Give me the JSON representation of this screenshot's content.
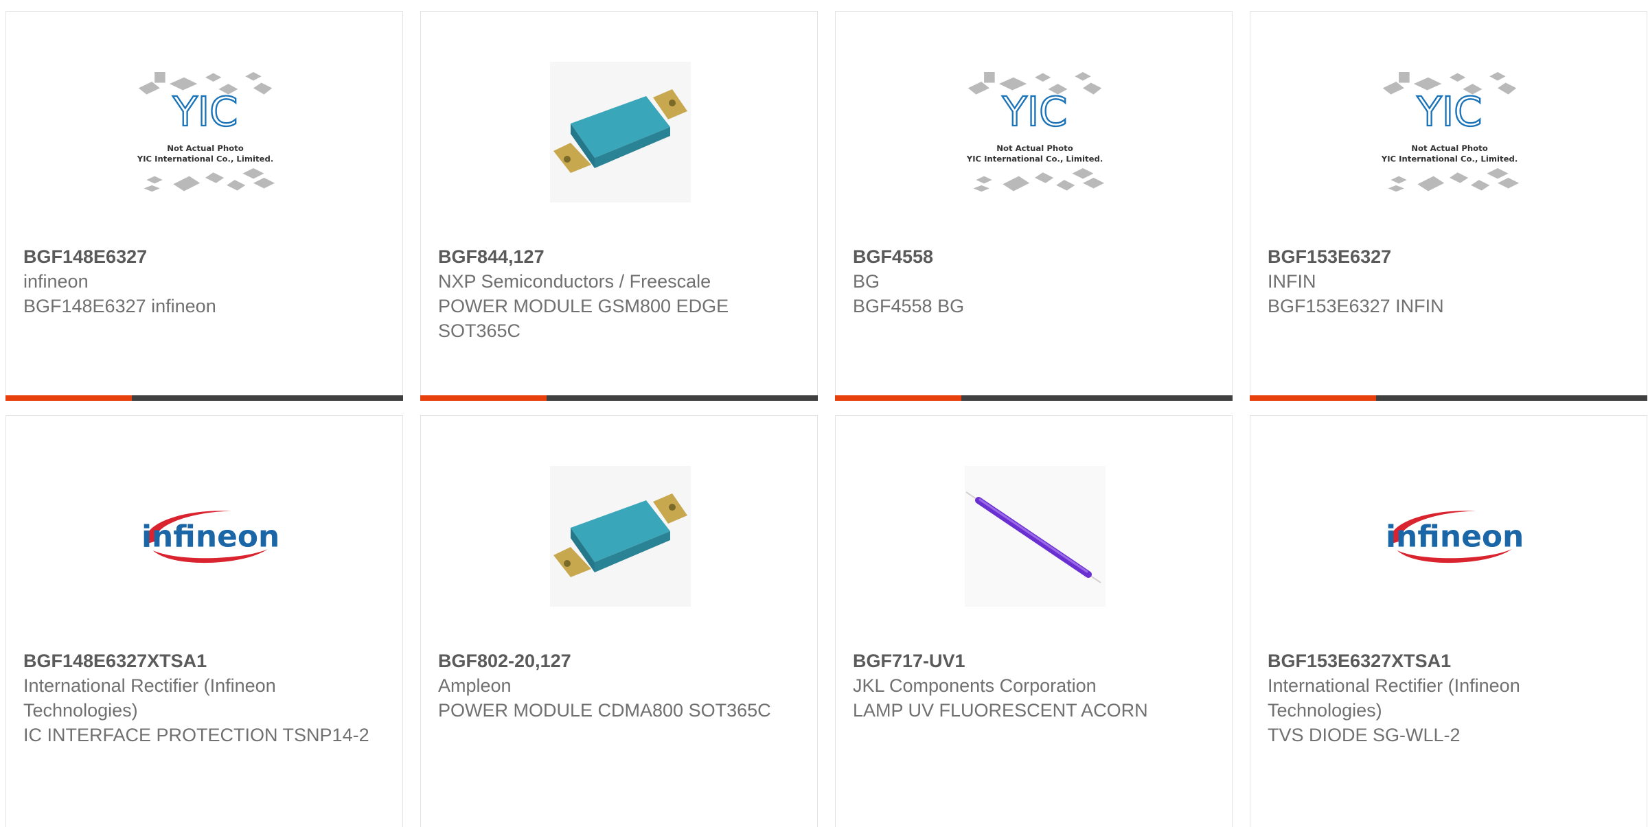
{
  "products": [
    {
      "part_number": "BGF148E6327",
      "manufacturer": "infineon",
      "description": "BGF148E6327 infineon",
      "image": "yic-placeholder",
      "image_caption_1": "Not Actual Photo",
      "image_caption_2": "YIC International Co., Limited."
    },
    {
      "part_number": "BGF844,127",
      "manufacturer": "NXP Semiconductors / Freescale",
      "description": "POWER MODULE GSM800 EDGE SOT365C",
      "image": "power-module-photo"
    },
    {
      "part_number": "BGF4558",
      "manufacturer": "BG",
      "description": "BGF4558 BG",
      "image": "yic-placeholder",
      "image_caption_1": "Not Actual Photo",
      "image_caption_2": "YIC International Co., Limited."
    },
    {
      "part_number": "BGF153E6327",
      "manufacturer": "INFIN",
      "description": "BGF153E6327 INFIN",
      "image": "yic-placeholder",
      "image_caption_1": "Not Actual Photo",
      "image_caption_2": "YIC International Co., Limited."
    },
    {
      "part_number": "BGF148E6327XTSA1",
      "manufacturer": "International Rectifier (Infineon Technologies)",
      "description": "IC INTERFACE PROTECTION TSNP14-2",
      "image": "infineon-logo",
      "logo_text": "infineon"
    },
    {
      "part_number": "BGF802-20,127",
      "manufacturer": "Ampleon",
      "description": "POWER MODULE CDMA800 SOT365C",
      "image": "power-module-photo"
    },
    {
      "part_number": "BGF717-UV1",
      "manufacturer": "JKL Components Corporation",
      "description": "LAMP UV FLUORESCENT ACORN",
      "image": "uv-lamp-photo"
    },
    {
      "part_number": "BGF153E6327XTSA1",
      "manufacturer": "International Rectifier (Infineon Technologies)",
      "description": "TVS DIODE SG-WLL-2",
      "image": "infineon-logo",
      "logo_text": "infineon"
    }
  ],
  "colors": {
    "accent": "#e8400c",
    "bar": "#404040",
    "text": "#707070",
    "part_number": "#5a5a5a",
    "yic_logo": "#1a73b8",
    "infineon_blue": "#1a66a6",
    "infineon_red": "#d9232e",
    "module_teal": "#3aa6b9",
    "lamp_violet": "#6a2fd0"
  }
}
